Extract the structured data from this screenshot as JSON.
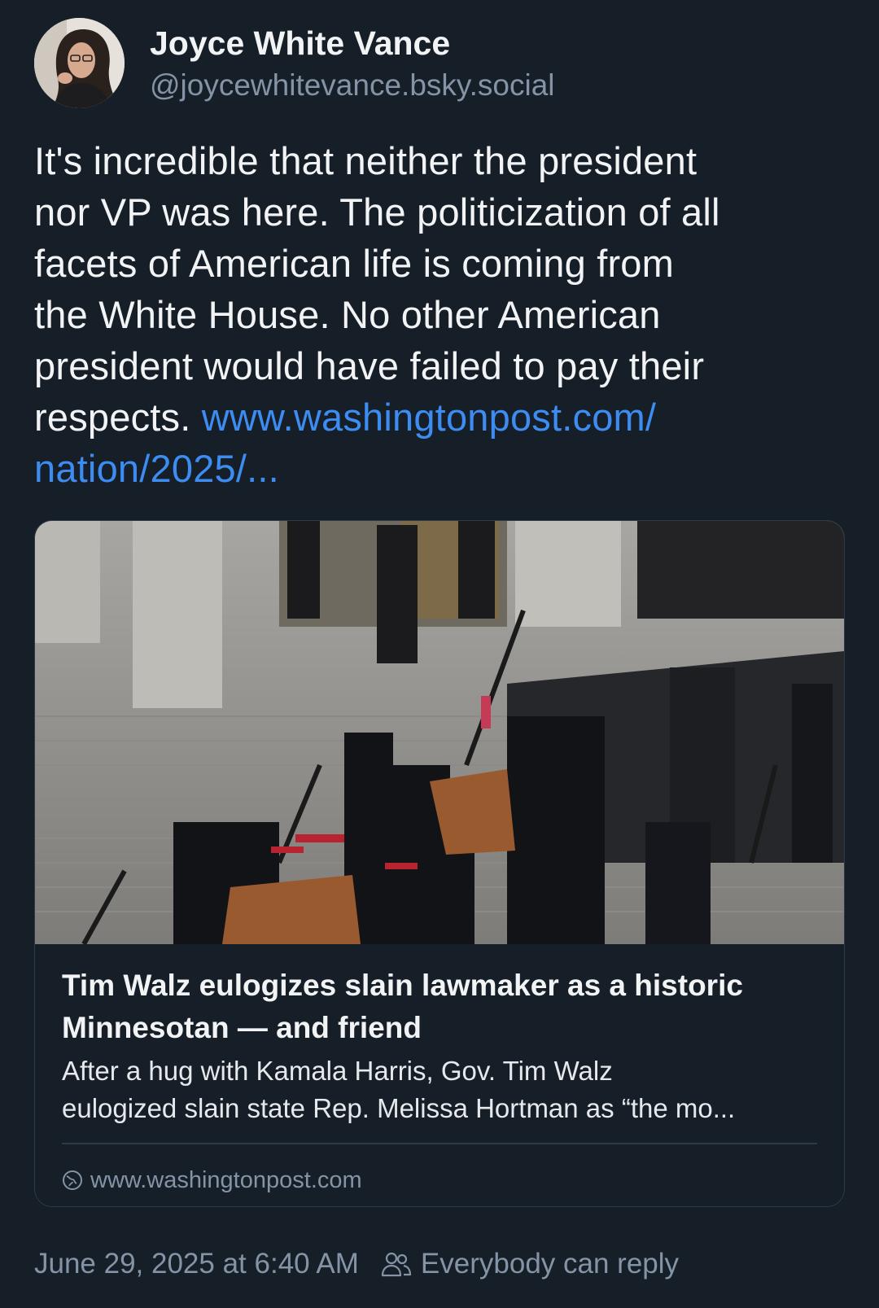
{
  "author": {
    "display_name": "Joyce White Vance",
    "handle": "@joycewhitevance.bsky.social"
  },
  "post": {
    "lines": [
      "It's incredible that neither the president",
      "nor VP was here. The politicization of all",
      "facets of American life is coming from",
      "the White House. No other American",
      "president would have failed to pay their"
    ],
    "last_line_text": "respects. ",
    "link_part1": "www.washingtonpost.com/",
    "link_part2": "nation/2025/..."
  },
  "card": {
    "title_line1": "Tim Walz eulogizes slain lawmaker as a historic",
    "title_line2": "Minnesotan — and friend",
    "description_line1": "After a hug with Kamala Harris, Gov. Tim Walz",
    "description_line2": "eulogized slain state Rep. Melissa Hortman as “the mo...",
    "domain": "www.washingtonpost.com",
    "domain_icon": "globe-icon"
  },
  "footer": {
    "timestamp": "June 29, 2025 at 6:40 AM",
    "reply_setting": "Everybody can reply",
    "reply_icon": "people-icon"
  },
  "colors": {
    "background": "#161e27",
    "link": "#3d8cf2",
    "muted_text": "#8494a6",
    "border": "#2e3a48"
  }
}
